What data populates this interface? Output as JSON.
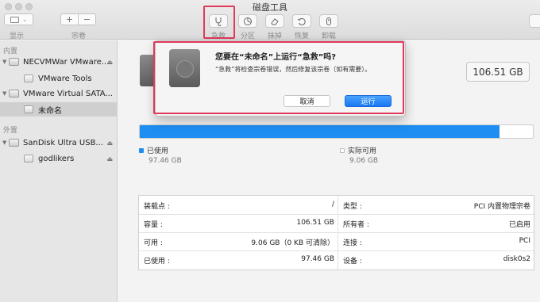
{
  "window": {
    "title": "磁盘工具"
  },
  "toolbar": {
    "display_label": "显示",
    "volume_label": "宗卷",
    "add_symbol": "+",
    "remove_symbol": "−",
    "tools": [
      {
        "label": "急救",
        "icon": "stethoscope-icon"
      },
      {
        "label": "分区",
        "icon": "pie-chart-icon"
      },
      {
        "label": "抹掉",
        "icon": "erase-icon"
      },
      {
        "label": "恢复",
        "icon": "restore-icon"
      },
      {
        "label": "卸载",
        "icon": "unmount-icon"
      }
    ]
  },
  "sidebar": {
    "internal_title": "内置",
    "external_title": "外置",
    "items": [
      {
        "label": "NECVMWar VMware...",
        "type": "disk",
        "eject": "⏏"
      },
      {
        "label": "VMware Tools",
        "type": "volume"
      },
      {
        "label": "VMware Virtual SATA...",
        "type": "disk"
      },
      {
        "label": "未命名",
        "type": "volume",
        "selected": true
      },
      {
        "label": "SanDisk Ultra USB...",
        "type": "disk",
        "eject": "⏏"
      },
      {
        "label": "godlikers",
        "type": "volume",
        "eject": "⏏"
      }
    ]
  },
  "dialog": {
    "title": "您要在“未命名”上运行“急救”吗?",
    "message": "“急救”将检查宗卷错误，然后修复该宗卷（如有需要）。",
    "cancel_label": "取消",
    "run_label": "运行"
  },
  "main": {
    "capacity": "106.51 GB",
    "used_fraction": 0.915,
    "used_label": "已使用",
    "used_value": "97.46 GB",
    "available_label": "实际可用",
    "available_value": "9.06 GB",
    "colors": {
      "used": "#1e8ef2",
      "available": "#ffffff"
    },
    "info": [
      {
        "key": "装载点 :",
        "value": "/"
      },
      {
        "key": "类型 :",
        "value": "PCI 内置物理宗卷"
      },
      {
        "key": "容量 :",
        "value": "106.51 GB"
      },
      {
        "key": "所有者 :",
        "value": "已启用"
      },
      {
        "key": "可用 :",
        "value": "9.06 GB（0 KB 可清除）"
      },
      {
        "key": "连接 :",
        "value": "PCI"
      },
      {
        "key": "已使用 :",
        "value": "97.46 GB"
      },
      {
        "key": "设备 :",
        "value": "disk0s2"
      }
    ]
  }
}
